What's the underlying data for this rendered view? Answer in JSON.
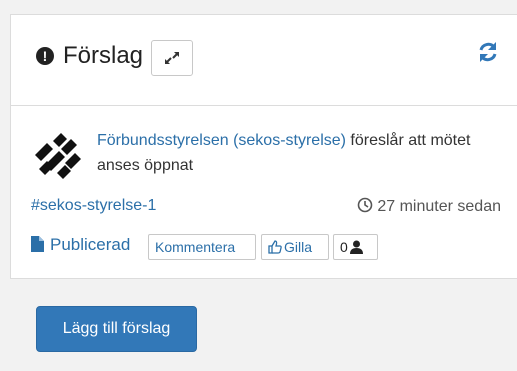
{
  "header": {
    "title": "Förslag",
    "icon": "exclamation-circle-icon",
    "expand_icon": "expand-arrows-icon",
    "refresh_icon": "refresh-icon"
  },
  "proposal": {
    "author": "Förbundsstyrelsen (sekos-styrelse)",
    "text": " föreslår att mötet anses öppnat",
    "tag": "#sekos-styrelse-1",
    "time": "27 minuter sedan",
    "status": "Publicerad",
    "comment_label": "Kommentera",
    "like_label": "Gilla",
    "supporters_count": "0"
  },
  "footer": {
    "add_button": "Lägg till förslag"
  },
  "colors": {
    "link": "#2b6fa8",
    "primary_button": "#3278b8"
  }
}
